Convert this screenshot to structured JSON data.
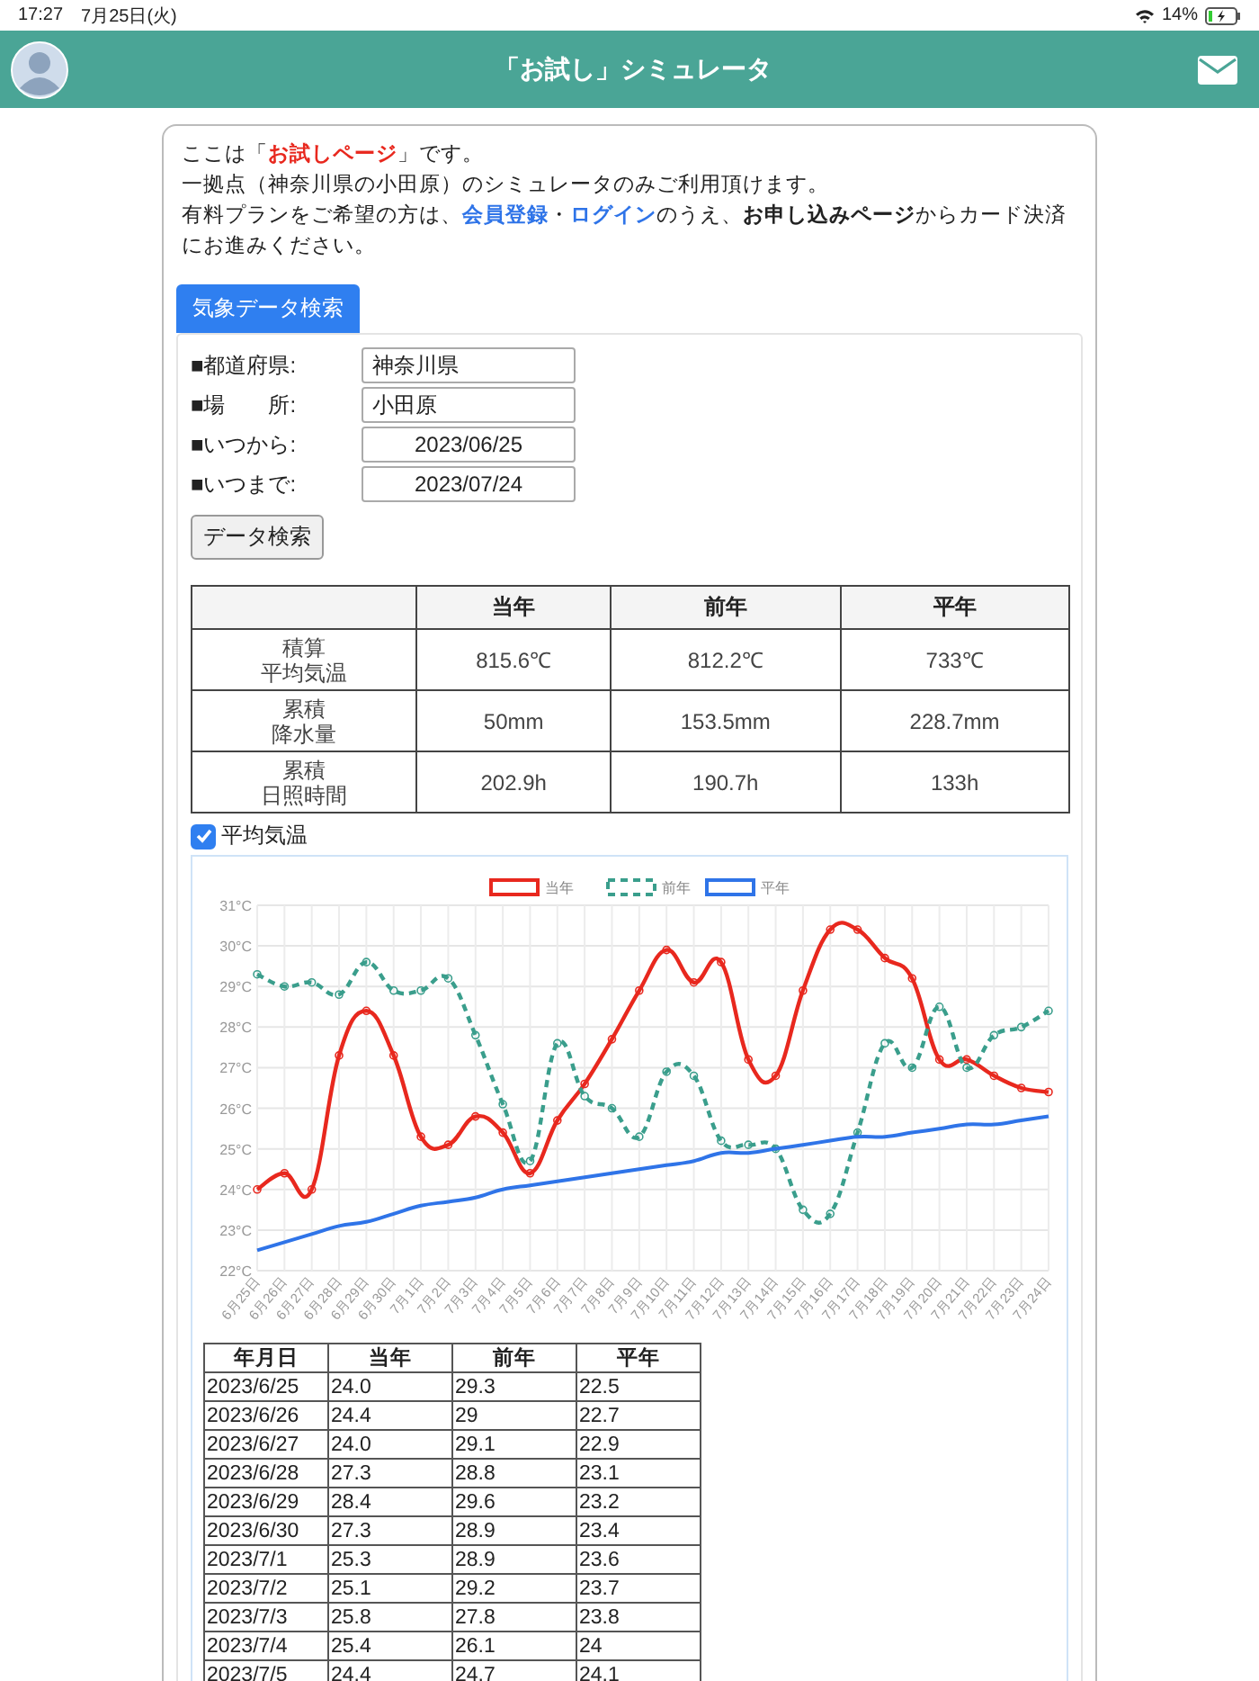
{
  "status_bar": {
    "time": "17:27",
    "date": "7月25日(火)",
    "battery": "14%"
  },
  "header": {
    "title": "「お試し」シミュレータ"
  },
  "intro": [
    [
      {
        "kind": "text",
        "text": "ここは「"
      },
      {
        "kind": "highlight",
        "text": "お試しページ"
      },
      {
        "kind": "text",
        "text": "」です。"
      }
    ],
    [
      {
        "kind": "text",
        "text": "一拠点（神奈川県の小田原）のシミュレータのみご利用頂けます。"
      }
    ],
    [
      {
        "kind": "text",
        "text": "有料プランをご希望の方は、"
      },
      {
        "kind": "link",
        "text": "会員登録"
      },
      {
        "kind": "text",
        "text": "・"
      },
      {
        "kind": "link",
        "text": "ログイン"
      },
      {
        "kind": "text",
        "text": "のうえ、**お申し込みページ**からカード決済にお進みください。"
      }
    ]
  ],
  "tabs": [
    {
      "label": "気象データ検索",
      "selected": true
    }
  ],
  "form": {
    "fields": [
      {
        "label": "■都道府県:",
        "value": "神奈川県",
        "kind": "text"
      },
      {
        "label": "■場　　所:",
        "value": "小田原",
        "kind": "text"
      },
      {
        "label": "■いつから:",
        "value": "2023/06/25",
        "kind": "date"
      },
      {
        "label": "■いつまで:",
        "value": "2023/07/24",
        "kind": "date"
      }
    ],
    "button": "データ検索"
  },
  "summary": {
    "columns": [
      "",
      "当年",
      "前年",
      "平年"
    ],
    "rows": [
      {
        "label": [
          "積算",
          "平均気温"
        ],
        "values": [
          "815.6℃",
          "812.2℃",
          "733℃"
        ]
      },
      {
        "label": [
          "累積",
          "降水量"
        ],
        "values": [
          "50mm",
          "153.5mm",
          "228.7mm"
        ]
      },
      {
        "label": [
          "累積",
          "日照時間"
        ],
        "values": [
          "202.9h",
          "190.7h",
          "133h"
        ]
      }
    ]
  },
  "chart_toggle": {
    "label": "平均気温",
    "checked": true
  },
  "chart": {
    "chart_data": {
      "type": "line",
      "grid": true,
      "legend": true,
      "categories": [
        "6月25日",
        "6月26日",
        "6月27日",
        "6月28日",
        "6月29日",
        "6月30日",
        "7月1日",
        "7月2日",
        "7月3日",
        "7月4日",
        "7月5日",
        "7月6日",
        "7月7日",
        "7月8日",
        "7月9日",
        "7月10日",
        "7月11日",
        "7月12日",
        "7月13日",
        "7月14日",
        "7月15日",
        "7月16日",
        "7月17日",
        "7月18日",
        "7月19日",
        "7月20日",
        "7月21日",
        "7月22日",
        "7月23日",
        "7月24日"
      ],
      "series": [
        {
          "name": "当年",
          "color": "#e8281e",
          "marker": true,
          "line_style": "solid",
          "values": [
            24.0,
            24.4,
            24.0,
            27.3,
            28.4,
            27.3,
            25.3,
            25.1,
            25.8,
            25.4,
            24.4,
            25.7,
            26.6,
            27.7,
            28.9,
            29.9,
            29.1,
            29.6,
            27.2,
            26.8,
            28.9,
            30.4,
            30.4,
            29.7,
            29.2,
            27.2,
            27.2,
            26.8,
            26.5,
            26.4
          ]
        },
        {
          "name": "前年",
          "color": "#3a9e8c",
          "marker": true,
          "line_style": "dashed",
          "values": [
            29.3,
            29,
            29.1,
            28.8,
            29.6,
            28.9,
            28.9,
            29.2,
            27.8,
            26.1,
            24.7,
            27.6,
            26.3,
            26.0,
            25.3,
            26.9,
            26.8,
            25.2,
            25.1,
            25.0,
            23.5,
            23.4,
            25.4,
            27.6,
            27.0,
            28.5,
            27.0,
            27.8,
            28.0,
            28.4
          ]
        },
        {
          "name": "平年",
          "color": "#2f74e8",
          "marker": false,
          "line_style": "solid",
          "values": [
            22.5,
            22.7,
            22.9,
            23.1,
            23.2,
            23.4,
            23.6,
            23.7,
            23.8,
            24,
            24.1,
            24.2,
            24.3,
            24.4,
            24.5,
            24.6,
            24.7,
            24.9,
            24.9,
            25.0,
            25.1,
            25.2,
            25.3,
            25.3,
            25.4,
            25.5,
            25.6,
            25.6,
            25.7,
            25.8
          ]
        }
      ],
      "ylim": [
        22,
        31
      ],
      "yticks": [
        {
          "value": 22,
          "label": "22°C"
        },
        {
          "value": 23,
          "label": "23°C"
        },
        {
          "value": 24,
          "label": "24°C"
        },
        {
          "value": 25,
          "label": "25°C"
        },
        {
          "value": 26,
          "label": "26°C"
        },
        {
          "value": 27,
          "label": "27°C"
        },
        {
          "value": 28,
          "label": "28°C"
        },
        {
          "value": 29,
          "label": "29°C"
        },
        {
          "value": 30,
          "label": "30°C"
        },
        {
          "value": 31,
          "label": "31°C"
        }
      ]
    }
  },
  "daily_table": {
    "columns": [
      "年月日",
      "当年",
      "前年",
      "平年"
    ],
    "rows": [
      [
        "2023/6/25",
        "24.0",
        "29.3",
        "22.5"
      ],
      [
        "2023/6/26",
        "24.4",
        "29",
        "22.7"
      ],
      [
        "2023/6/27",
        "24.0",
        "29.1",
        "22.9"
      ],
      [
        "2023/6/28",
        "27.3",
        "28.8",
        "23.1"
      ],
      [
        "2023/6/29",
        "28.4",
        "29.6",
        "23.2"
      ],
      [
        "2023/6/30",
        "27.3",
        "28.9",
        "23.4"
      ],
      [
        "2023/7/1",
        "25.3",
        "28.9",
        "23.6"
      ],
      [
        "2023/7/2",
        "25.1",
        "29.2",
        "23.7"
      ],
      [
        "2023/7/3",
        "25.8",
        "27.8",
        "23.8"
      ],
      [
        "2023/7/4",
        "25.4",
        "26.1",
        "24"
      ],
      [
        "2023/7/5",
        "24.4",
        "24.7",
        "24.1"
      ]
    ]
  }
}
